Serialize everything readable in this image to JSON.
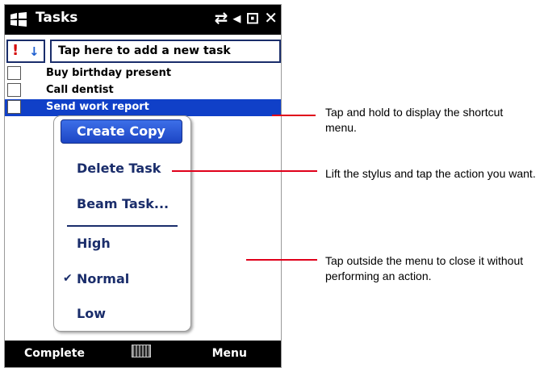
{
  "titlebar": {
    "app_title": "Tasks",
    "icons": [
      "windows-start-icon",
      "connectivity-icon",
      "volume-icon",
      "battery-icon",
      "close-icon"
    ],
    "glyph_connectivity": "⇄",
    "glyph_volume": "◂",
    "glyph_battery": "⊡",
    "glyph_close": "✕"
  },
  "new_task": {
    "priority_high": "!",
    "priority_low": "↓",
    "placeholder": "Tap here to add a new task"
  },
  "tasks": [
    {
      "label": "Buy birthday present",
      "selected": false
    },
    {
      "label": "Call dentist",
      "selected": false
    },
    {
      "label": "Send work report",
      "selected": true
    }
  ],
  "context_menu": {
    "items": [
      {
        "label": "Create Copy",
        "highlighted": true
      },
      {
        "label": "Delete Task"
      },
      {
        "label": "Beam Task..."
      },
      {
        "label": "High"
      },
      {
        "label": "Normal",
        "checked": true,
        "check_glyph": "✔"
      },
      {
        "label": "Low"
      }
    ]
  },
  "softkeys": {
    "left": "Complete",
    "right": "Menu"
  },
  "callouts": [
    "Tap and hold to display the shortcut menu.",
    "Lift the stylus and tap the action you want.",
    "Tap outside the menu to close it without performing an action."
  ],
  "colors": {
    "selection": "#1040c8",
    "menu_text": "#1a2d6b",
    "callout_line": "#e0001a"
  }
}
